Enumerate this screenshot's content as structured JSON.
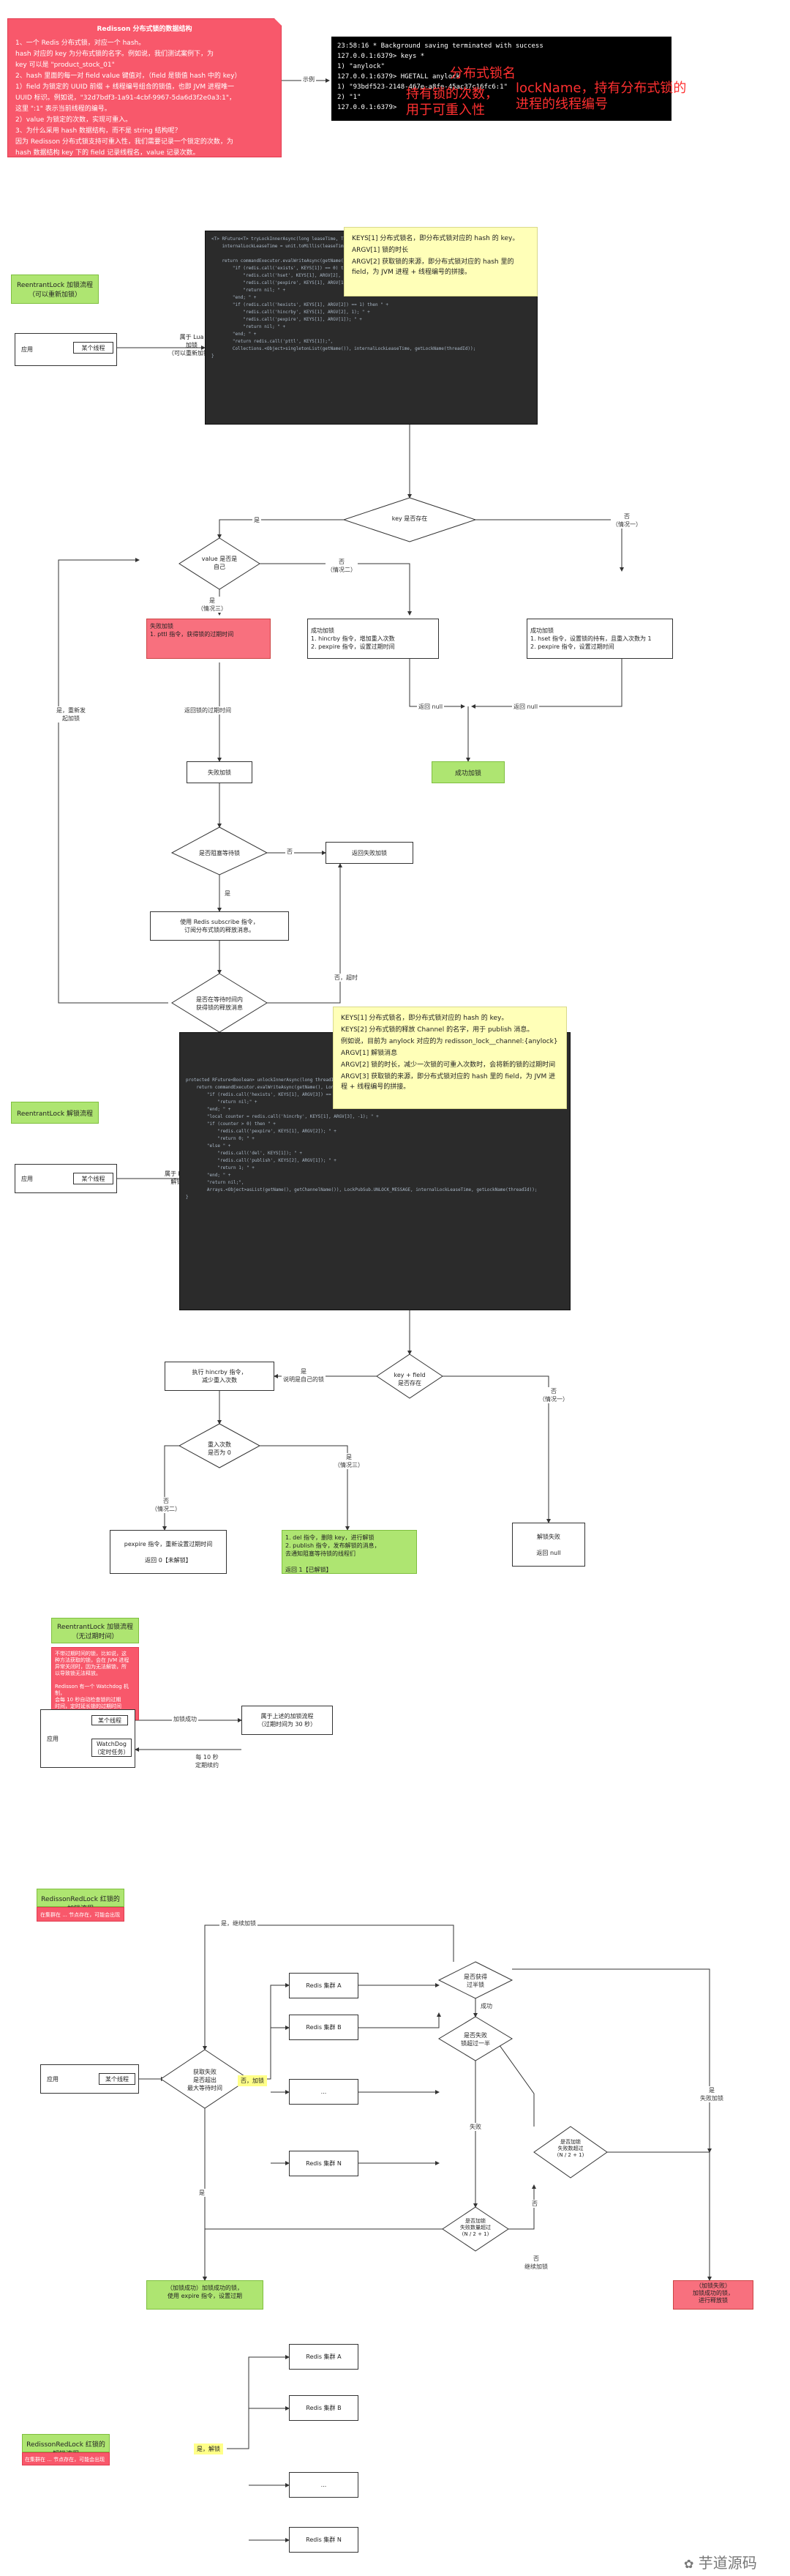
{
  "s1": {
    "note_title": "Redisson 分布式锁的数据结构",
    "note_lines": [
      "1、一个 Redis 分布式锁，对应一个 hash。",
      "hash 对应的 key 为分布式锁的名字。例如说，我们测试案例下，为",
      "key 可以是 \"product_stock_01\"",
      "2、hash 里面的每一对 field value 键值对，（field 是锁值 hash 中的 key）",
      "    1）field 为锁定的 UUID 前缀 + 线程编号组合的锁值，也即 JVM 进程唯一",
      "UUID 标识。例如说，\"32d7bdf3-1a91-4cbf-9967-5da6d3f2e0a3:1\"，",
      "这里 \":1\" 表示当前线程的编号。",
      "    2）value 为锁定的次数，实现可重入。",
      "3、为什么采用 hash 数据结构，而不是 string 结构呢？",
      "因为 Redisson 分布式锁支持可重入性，我们需要记录一个锁定的次数，为",
      "hash 数据结构 key 下的 field 记录线程名，value 记录次数。"
    ],
    "arrow_label": "示例",
    "terminal_lines": [
      "23:58:16 * Background saving terminated with success",
      "127.0.0.1:6379> keys *",
      "1) \"anylock\"",
      "127.0.0.1:6379> HGETALL anylock",
      "1) \"93bdf523-2148-467e-a8fe-45ac37c16fc6:1\"",
      "2) \"1\"",
      "127.0.0.1:6379>"
    ],
    "overlays": [
      "分布式锁名",
      "持有锁的次数，",
      "用于可重入性",
      "lockName，持有分布式锁的",
      "进程的线程编号"
    ]
  },
  "s2": {
    "title": "ReentrantLock 加锁流程\n（可以重新加锁）",
    "caller": "应用",
    "thread": "某个线程",
    "eval_label": "属于 Lua\n加锁\n（可以重新加锁）",
    "yellow_lines": [
      "KEYS[1] 分布式锁名，即分布式锁对应的 hash 的 key。",
      "ARGV[1] 锁的时长",
      "ARGV[2] 获取锁的来源，即分布式锁对应的 hash 里的 field，为 JVM 进程 + 线程编号的拼接。"
    ],
    "code_lines": [
      "<T> RFuture<T> tryLockInnerAsync(long leaseTime, TimeUnit unit, long threadId, RedisStrictCommand<T> command) {",
      "    internalLockLeaseTime = unit.toMillis(leaseTime);",
      "",
      "    return commandExecutor.evalWriteAsync(getName(), LongCodec.INSTANCE, command,",
      "        \"if (redis.call('exists', KEYS[1]) == 0) then \" +",
      "            \"redis.call('hset', KEYS[1], ARGV[2], 1); \" +",
      "            \"redis.call('pexpire', KEYS[1], ARGV[1]); \" +",
      "            \"return nil; \" +",
      "        \"end; \" +",
      "        \"if (redis.call('hexists', KEYS[1], ARGV[2]) == 1) then \" +",
      "            \"redis.call('hincrby', KEYS[1], ARGV[2], 1); \" +",
      "            \"redis.call('pexpire', KEYS[1], ARGV[1]); \" +",
      "            \"return nil; \" +",
      "        \"end; \" +",
      "        \"return redis.call('pttl', KEYS[1]);\",",
      "        Collections.<Object>singletonList(getName()), internalLockLeaseTime, getLockName(threadId));",
      "}"
    ],
    "d_key_exists": "key 是否存在",
    "label_yes_exists": "是",
    "label_no_exists": "否\n（情况一）",
    "d_value_mine": "value 是否是\n自己",
    "label_no_mine": "否\n（情况二）",
    "label_yes_mine": "是\n（情况三）",
    "red_box": "失败加锁\n1. pttl 指令，获得锁的过期时间",
    "mid_box": "成功加锁\n1. hincrby 指令，增加重入次数\n2. pexpire 指令，设置过期时间",
    "right_box": "成功加锁\n1. hset 指令，设置锁的持有，且重入次数为 1\n2. pexpire 指令，设置过期时间",
    "label_return_null_1": "返回 null",
    "label_return_null_2": "返回 null",
    "success": "成功加锁",
    "label_return_ttl": "返回锁的过期时间",
    "fail": "失败加锁",
    "d_block": "是否阻塞等待锁",
    "label_no_block": "否",
    "label_yes_block": "是",
    "return_fail": "返回失败加锁",
    "subscribe_box": "使用 Redis subscribe 指令，\n订阅分布式锁的释放消息。",
    "d_timeout": "是否在等待时间内\n获得锁的释放消息",
    "label_retry": "是，重新发\n起加锁",
    "label_timeout": "否，超时"
  },
  "s3": {
    "title": "ReentrantLock 解锁流程",
    "caller": "应用",
    "thread": "某个线程",
    "eval_label": "属于 Lua\n解锁",
    "yellow_lines": [
      "KEYS[1] 分布式锁名，即分布式锁对应的 hash 的 key。",
      "KEYS[2] 分布式锁的释放 Channel 的名字，用于 publish 消息。",
      "例如说，目前为 anylock 对应的为 redisson_lock__channel:{anylock}",
      "ARGV[1] 解锁消息",
      "ARGV[2] 锁的时长，减少一次锁的可重入次数时，会将新的锁的过期时间",
      "ARGV[3] 获取锁的来源，即分布式锁对应的 hash 里的 field，为 JVM 进程 + 线程编号的拼接。"
    ],
    "code_lines": [
      "protected RFuture<Boolean> unlockInnerAsync(long threadId) {",
      "    return commandExecutor.evalWriteAsync(getName(), LongCodec.INSTANCE, RedisCommands.EVAL_BOOLEAN,",
      "        \"if (redis.call('hexists', KEYS[1], ARGV[3]) == 0) then \" +",
      "            \"return nil;\" +",
      "        \"end; \" +",
      "        \"local counter = redis.call('hincrby', KEYS[1], ARGV[3], -1); \" +",
      "        \"if (counter > 0) then \" +",
      "            \"redis.call('pexpire', KEYS[1], ARGV[2]); \" +",
      "            \"return 0; \" +",
      "        \"else \" +",
      "            \"redis.call('del', KEYS[1]); \" +",
      "            \"redis.call('publish', KEYS[2], ARGV[1]); \" +",
      "            \"return 1; \" +",
      "        \"end; \" +",
      "        \"return nil;\",",
      "        Arrays.<Object>asList(getName(), getChannelName()), LockPubSub.UNLOCK_MESSAGE, internalLockLeaseTime, getLockName(threadId));",
      "}"
    ],
    "d_exists": "key + field\n是否存在",
    "label_yes": "是\n说明是自己的锁",
    "label_no": "否\n（情况一）",
    "hincrby_box": "执行 hincrby 指令，\n减少重入次数",
    "d_zero": "重入次数\n是否为 0",
    "label_no2": "否\n（情况二）",
    "label_yes3": "是\n（情况三）",
    "pexpire_box": "pexpire 指令，重新设置过期时间\n\n返回 0【未解锁】",
    "del_box": "1. del 指令，删除 key，进行解锁\n2. publish 指令，发布解锁的消息，\n去通知阻塞等待锁的线程们\n\n返回 1【已解锁】",
    "fail_box": "解锁失败\n\n返回 null"
  },
  "s4": {
    "title": "ReentrantLock 加锁流程\n（无过期时间）",
    "red_lines": [
      "不带过期时间的锁，比如说，这",
      "种方法获取的锁，会在 JVM 进程",
      "异常关闭时，因为无法解锁，所",
      "以导致锁无法释放。",
      "",
      "Redisson 有一个 Watchdog 机制，",
      "会每 10 秒自动检查锁的过期",
      "时间，定时延长锁的过期时间",
      "到 30 秒。",
      "",
      "注意，WatchDog 只会在没有过期",
      "时间的锁才会生效！"
    ],
    "caller": "应用",
    "thread": "某个线程",
    "watchdog": "WatchDog\n（定时任务）",
    "label_lock": "加锁成功",
    "right_box": "属于上述的加锁流程\n（过期时间为 30 秒）",
    "label_renew": "每 10 秒\n定期续约"
  },
  "s5": {
    "title": "RedissonRedLock 红锁的加锁流程",
    "red_lines": [
      "在集群在 ... 节点存在，可能会出现问题..."
    ],
    "caller": "应用",
    "thread": "某个线程",
    "d_timeout": "获取失败\n是否超出\n最大等待时间",
    "label_no_fail": "否，加锁",
    "nodes": [
      "Redis 集群 A",
      "Redis 集群 B",
      "...",
      "Redis 集群 N"
    ],
    "label_retry": "是，继续加锁",
    "d_ok": "是否获得\n过半锁",
    "label_ok_yes": "成功",
    "d_fail_check": "是否失败\n锁超过一半",
    "label_fail": "失败",
    "d_leftover": "是否加锁\n失败数超过\n(N / 2 + 1)",
    "d_final": "是否加锁\n失败数量超过\n(N / 2 + 1)",
    "label_yes": "是",
    "label_no": "否",
    "label_yes_fail": "是\n失败加锁",
    "label_no_continue": "否\n继续加锁",
    "success_box": "（加锁成功）加锁成功的锁，\n使用 expire 指令，设置过期",
    "fail_box": "（加锁失败）\n加锁成功的锁，\n进行释放锁"
  },
  "s6": {
    "title": "RedissonRedLock 红锁的解锁流程",
    "red_text": "在集群在 ... 节点存在，可能会出现问题",
    "label": "是，解锁",
    "nodes": [
      "Redis 集群 A",
      "Redis 集群 B",
      "...",
      "Redis 集群 N"
    ]
  },
  "watermark": "芋道源码"
}
